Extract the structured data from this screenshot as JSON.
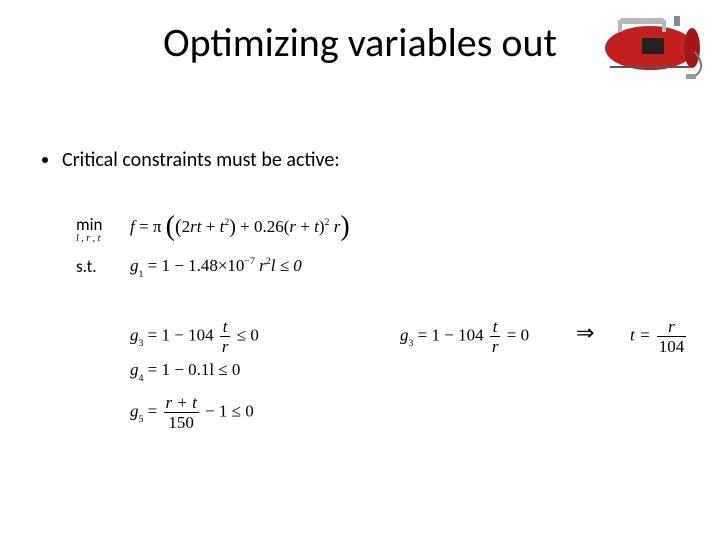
{
  "title": "Optimizing variables out",
  "bullet": "Critical constraints must be active:",
  "labels": {
    "min": "min",
    "min_over": "l , r , t",
    "st": "s.t.",
    "f": "f",
    "g1": "g",
    "g1n": "1",
    "g3": "g",
    "g3n": "3",
    "g4": "g",
    "g4n": "4",
    "g5": "g",
    "g5n": "5"
  },
  "expr": {
    "objective_lead": " = π ",
    "obj_inner1": "2",
    "obj_rt": "rt",
    "obj_plus1": " + ",
    "obj_t": "t",
    "obj_sq1": "2",
    "obj_mid": " + 0.26(",
    "obj_r": "r",
    "obj_plus2": " + ",
    "obj_t2": "t",
    "obj_close": ")",
    "obj_sq2": "2",
    "obj_trail_r": " r",
    "g1_body_a": " = 1 − 1.48×10",
    "g1_exp": "−7",
    "g1_body_b": " r",
    "g1_sq": "2",
    "g1_body_c": "l ≤ 0",
    "g3_body_a": " = 1 − 104 ",
    "g3_frac_n": "t",
    "g3_frac_d": "r",
    "g3_le": " ≤ 0",
    "g3_eq": " = 0",
    "g4_body": " = 1 − 0.1l ≤ 0",
    "g5_body_a": " = ",
    "g5_frac_n": "r + t",
    "g5_frac_d": "150",
    "g5_body_b": " − 1 ≤ 0",
    "implies": "⇒",
    "t_eq": "t = ",
    "t_frac_n": "r",
    "t_frac_d": "104"
  }
}
